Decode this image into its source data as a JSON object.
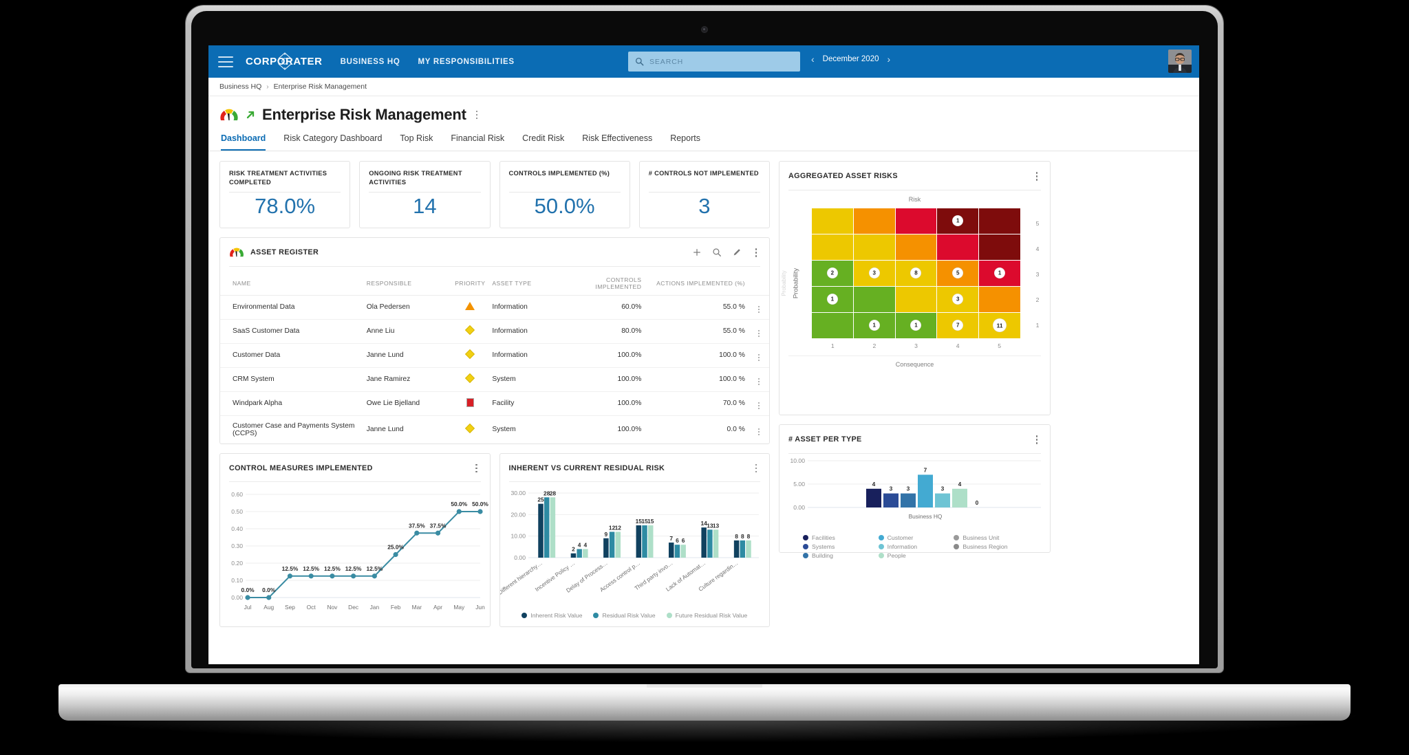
{
  "topnav": {
    "brand": "CORPORATER",
    "links": [
      "BUSINESS HQ",
      "MY RESPONSIBILITIES"
    ],
    "search_placeholder": "SEARCH",
    "search_value": "",
    "period": "December 2020",
    "prev_icon": "chevron-left-icon",
    "next_icon": "chevron-right-icon"
  },
  "breadcrumb": {
    "root": "Business HQ",
    "sep": "›",
    "current": "Enterprise Risk Management"
  },
  "page": {
    "title": "Enterprise Risk Management"
  },
  "tabs": [
    {
      "label": "Dashboard",
      "active": true
    },
    {
      "label": "Risk Category Dashboard",
      "active": false
    },
    {
      "label": "Top Risk",
      "active": false
    },
    {
      "label": "Financial Risk",
      "active": false
    },
    {
      "label": "Credit Risk",
      "active": false
    },
    {
      "label": "Risk Effectiveness",
      "active": false
    },
    {
      "label": "Reports",
      "active": false
    }
  ],
  "kpis": [
    {
      "label": "RISK TREATMENT ACTIVITIES COMPLETED",
      "value": "78.0%"
    },
    {
      "label": "ONGOING RISK TREATMENT ACTIVITIES",
      "value": "14"
    },
    {
      "label": "CONTROLS IMPLEMENTED (%)",
      "value": "50.0%"
    },
    {
      "label": "# CONTROLS NOT IMPLEMENTED",
      "value": "3"
    }
  ],
  "asset_register": {
    "title": "ASSET REGISTER",
    "actions": [
      "add-icon",
      "search-icon",
      "edit-icon",
      "more-icon"
    ],
    "columns": [
      "NAME",
      "RESPONSIBLE",
      "PRIORITY",
      "ASSET TYPE",
      "CONTROLS IMPLEMENTED",
      "ACTIONS IMPLEMENTED (%)"
    ],
    "rows": [
      {
        "name": "Environmental Data",
        "responsible": "Ola Pedersen",
        "priority": "triangle-orange",
        "type": "Information",
        "controls": "60.0%",
        "actions": "55.0 %"
      },
      {
        "name": "SaaS Customer Data",
        "responsible": "Anne Liu",
        "priority": "diamond-yellow",
        "type": "Information",
        "controls": "80.0%",
        "actions": "55.0 %"
      },
      {
        "name": "Customer Data",
        "responsible": "Janne Lund",
        "priority": "diamond-yellow",
        "type": "Information",
        "controls": "100.0%",
        "actions": "100.0 %"
      },
      {
        "name": "CRM System",
        "responsible": "Jane Ramirez",
        "priority": "diamond-yellow",
        "type": "System",
        "controls": "100.0%",
        "actions": "100.0 %"
      },
      {
        "name": "Windpark Alpha",
        "responsible": "Owe Lie Bjelland",
        "priority": "square-red",
        "type": "Facility",
        "controls": "100.0%",
        "actions": "70.0 %"
      },
      {
        "name": "Customer Case and Payments System (CCPS)",
        "responsible": "Janne Lund",
        "priority": "diamond-yellow",
        "type": "System",
        "controls": "100.0%",
        "actions": "0.0 %"
      }
    ]
  },
  "chart_data": [
    {
      "id": "control-measures",
      "type": "line",
      "title": "CONTROL MEASURES IMPLEMENTED",
      "xlabel": "",
      "ylabel": "",
      "ylim": [
        0.0,
        0.6
      ],
      "yticks": [
        "0.00",
        "0.10",
        "0.20",
        "0.30",
        "0.40",
        "0.50",
        "0.60"
      ],
      "grid": true,
      "categories": [
        "Jul",
        "Aug",
        "Sep",
        "Oct",
        "Nov",
        "Dec",
        "Jan",
        "Feb",
        "Mar",
        "Apr",
        "May",
        "Jun"
      ],
      "values": [
        0.0,
        0.0,
        0.125,
        0.125,
        0.125,
        0.125,
        0.125,
        0.25,
        0.375,
        0.375,
        0.5,
        0.5
      ],
      "point_labels": [
        "0.0%",
        "0.0%",
        "12.5%",
        "12.5%",
        "12.5%",
        "12.5%",
        "12.5%",
        "25.0%",
        "37.5%",
        "37.5%",
        "50.0%",
        "50.0%"
      ],
      "series_color": "#3a8ca3"
    },
    {
      "id": "inherent-vs-residual",
      "type": "bar",
      "title": "INHERENT VS CURRENT RESIDUAL RISK",
      "xlabel": "",
      "ylabel": "",
      "ylim": [
        0,
        30
      ],
      "yticks": [
        "0.00",
        "10.00",
        "20.00",
        "30.00"
      ],
      "grid": true,
      "legend_position": "bottom",
      "categories": [
        "Different hierarchy…",
        "Incentive Policy …",
        "Delay of Process…",
        "Access control p…",
        "Third party invo…",
        "Lack of Automat…",
        "Culture regardin…"
      ],
      "series": [
        {
          "name": "Inherent Risk Value",
          "color": "#10415f",
          "values": [
            25,
            2,
            9,
            15,
            7,
            14,
            8
          ]
        },
        {
          "name": "Residual Risk Value",
          "color": "#2e8ba3",
          "values": [
            28,
            4,
            12,
            15,
            6,
            13,
            8
          ]
        },
        {
          "name": "Future Residual Risk Value",
          "color": "#aedfc8",
          "values": [
            28,
            4,
            12,
            15,
            6,
            13,
            8
          ]
        }
      ]
    },
    {
      "id": "aggregated-asset-risks",
      "type": "heatmap",
      "title": "AGGREGATED ASSET RISKS",
      "plot_title": "Risk",
      "xlabel": "Consequence",
      "ylabel": "Probability",
      "x": [
        "1",
        "2",
        "3",
        "4",
        "5"
      ],
      "y": [
        "5",
        "4",
        "3",
        "2",
        "1"
      ],
      "cells": [
        [
          {
            "color": "#edc800",
            "count": null
          },
          {
            "color": "#f59100",
            "count": null
          },
          {
            "color": "#dc0a2d",
            "count": null
          },
          {
            "color": "#7e0c0c",
            "count": "1"
          },
          {
            "color": "#7e0c0c",
            "count": null
          }
        ],
        [
          {
            "color": "#edc800",
            "count": null
          },
          {
            "color": "#edc800",
            "count": null
          },
          {
            "color": "#f59100",
            "count": null
          },
          {
            "color": "#dc0a2d",
            "count": null
          },
          {
            "color": "#7e0c0c",
            "count": null
          }
        ],
        [
          {
            "color": "#66b022",
            "count": "2"
          },
          {
            "color": "#edc800",
            "count": "3"
          },
          {
            "color": "#edc800",
            "count": "8"
          },
          {
            "color": "#f59100",
            "count": "5"
          },
          {
            "color": "#dc0a2d",
            "count": "1"
          }
        ],
        [
          {
            "color": "#66b022",
            "count": "1"
          },
          {
            "color": "#66b022",
            "count": null
          },
          {
            "color": "#edc800",
            "count": null
          },
          {
            "color": "#edc800",
            "count": "3"
          },
          {
            "color": "#f59100",
            "count": null
          }
        ],
        [
          {
            "color": "#66b022",
            "count": null
          },
          {
            "color": "#66b022",
            "count": "1"
          },
          {
            "color": "#66b022",
            "count": "1"
          },
          {
            "color": "#edc800",
            "count": "7"
          },
          {
            "color": "#edc800",
            "count": "11"
          }
        ]
      ]
    },
    {
      "id": "asset-per-type",
      "type": "bar",
      "title": "# ASSET PER TYPE",
      "xlabel": "Business HQ",
      "ylabel": "",
      "ylim": [
        0,
        10
      ],
      "yticks": [
        "0.00",
        "5.00",
        "10.00"
      ],
      "grid": true,
      "legend_position": "bottom",
      "categories": [
        "Facilities",
        "Systems",
        "Building",
        "Customer",
        "Information",
        "People",
        "Business Unit",
        "Business Region"
      ],
      "values": [
        4,
        3,
        3,
        7,
        3,
        4,
        0,
        null
      ],
      "colors": [
        "#18205c",
        "#2b4b96",
        "#3273a8",
        "#43aad2",
        "#6ec4d4",
        "#aedfc8",
        "#9a9a9a",
        "#8a8a8a"
      ]
    }
  ]
}
